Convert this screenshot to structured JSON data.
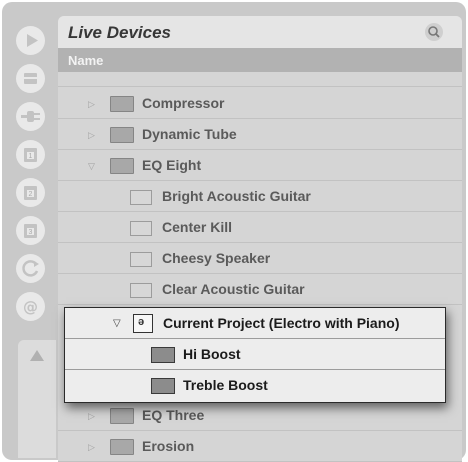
{
  "browser": {
    "title": "Live Devices",
    "column_header": "Name",
    "search_icon": "search-icon",
    "icons": {
      "rail": [
        "play-icon",
        "categories-icon",
        "plugin-icon",
        "folder-1-icon",
        "folder-2-icon",
        "folder-3-icon",
        "refresh-icon",
        "at-icon"
      ],
      "collapse": "collapse-up-icon"
    },
    "rows": [
      {
        "label": "Compressor",
        "expanded": false,
        "type": "folder"
      },
      {
        "label": "Dynamic Tube",
        "expanded": false,
        "type": "folder"
      },
      {
        "label": "EQ Eight",
        "expanded": true,
        "type": "folder"
      },
      {
        "label": "Bright Acoustic Guitar",
        "type": "preset"
      },
      {
        "label": "Center Kill",
        "type": "preset"
      },
      {
        "label": "Cheesy Speaker",
        "type": "preset"
      },
      {
        "label": "Clear Acoustic Guitar",
        "type": "preset"
      },
      {
        "label": "EQ Three",
        "expanded": false,
        "type": "folder"
      },
      {
        "label": "Erosion",
        "expanded": false,
        "type": "folder"
      }
    ],
    "overlay": {
      "project_label": "Current Project (Electro with Piano)",
      "items": [
        "Hi Boost",
        "Treble Boost"
      ]
    }
  }
}
